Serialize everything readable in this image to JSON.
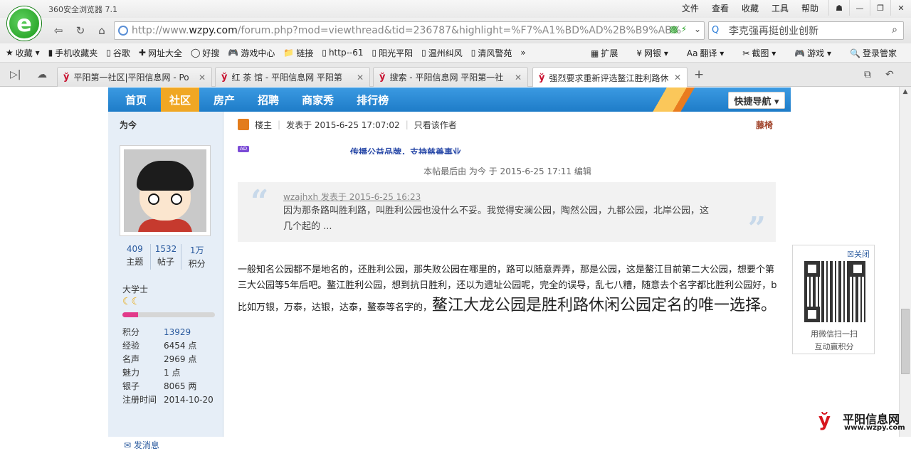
{
  "browser": {
    "title": "360安全浏览器 7.1",
    "logo_letter": "e",
    "menu": [
      "文件",
      "查看",
      "收藏",
      "工具",
      "帮助"
    ],
    "window_buttons": [
      "☗",
      "—",
      "❐",
      "✕"
    ]
  },
  "address": {
    "url_prefix": "http://www.",
    "url_domain": "wzpy.com",
    "url_rest": "/forum.php?mod=viewthread&tid=236787&highlight=%F7%A1%BD%AD%2B%B9%AB%",
    "search_text": "李克强再挺创业创新"
  },
  "bookmarks": {
    "items": [
      {
        "icon": "★",
        "label": "收藏"
      },
      {
        "icon": "▮",
        "label": "手机收藏夹"
      },
      {
        "icon": "▯",
        "label": "谷歌"
      },
      {
        "icon": "✚",
        "label": "网址大全"
      },
      {
        "icon": "◯",
        "label": "好搜"
      },
      {
        "icon": "🎮",
        "label": "游戏中心"
      },
      {
        "icon": "📁",
        "label": "链接"
      },
      {
        "icon": "▯",
        "label": "http--61"
      },
      {
        "icon": "▯",
        "label": "阳光平阳"
      },
      {
        "icon": "▯",
        "label": "温州纠风"
      },
      {
        "icon": "▯",
        "label": "清风警苑"
      }
    ],
    "more": "»",
    "right": [
      {
        "icon": "▦",
        "label": "扩展"
      },
      {
        "icon": "¥",
        "label": "网银"
      },
      {
        "icon": "Aa",
        "label": "翻译"
      },
      {
        "icon": "✂",
        "label": "截图"
      },
      {
        "icon": "🎮",
        "label": "游戏"
      },
      {
        "icon": "🔍",
        "label": "登录管家"
      }
    ]
  },
  "tabs": [
    {
      "label": "平阳第一社区|平阳信息网 - Po",
      "active": false
    },
    {
      "label": "红 茶 馆 - 平阳信息网 平阳第",
      "active": false
    },
    {
      "label": "搜索 - 平阳信息网 平阳第一社",
      "active": false
    },
    {
      "label": "强烈要求重新评选鳌江胜利路休",
      "active": true
    }
  ],
  "site": {
    "nav": [
      "首页",
      "社区",
      "房产",
      "招聘",
      "商家秀",
      "排行榜"
    ],
    "current": "社区",
    "quick_nav": "快捷导航 ▾"
  },
  "user": {
    "name": "为今",
    "stats": [
      {
        "n": "409",
        "l": "主题"
      },
      {
        "n": "1532",
        "l": "帖子"
      },
      {
        "n": "1万",
        "l": "积分"
      }
    ],
    "rank": "大学士",
    "level_progress": 0.17,
    "profile": [
      {
        "k": "积分",
        "v": "13929",
        "link": true
      },
      {
        "k": "经验",
        "v": "6454 点",
        "link": false
      },
      {
        "k": "名声",
        "v": "2969 点",
        "link": false
      },
      {
        "k": "魅力",
        "v": "1 点",
        "link": false
      },
      {
        "k": "银子",
        "v": "8065 两",
        "link": false
      },
      {
        "k": "注册时间",
        "v": "2014-10-20",
        "link": false
      }
    ],
    "send_message": "发消息"
  },
  "post": {
    "role": "楼主",
    "posted": "发表于 2015-6-25 17:07:02",
    "only_author": "只看该作者",
    "floor": "藤椅",
    "ad_badge": "AD",
    "ad_text": "传播公益品牌，支持慈善事业",
    "edit_note": "本帖最后由 为今 于 2015-6-25 17:11 编辑",
    "quote": {
      "author": "wzajhxh 发表于 2015-6-25 16:23",
      "text": "因为那条路叫胜利路，叫胜利公园也没什么不妥。我觉得安澜公园，陶然公园，九都公园，北岸公园，这几个起的 ..."
    },
    "body": "一般知名公园都不是地名的，还胜利公园，那失败公园在哪里的，路可以随意弄弄，那是公园，这是鳌江目前第二大公园，想要个第三大公园等5年后吧。鳌江胜利公园，想到抗日胜利，还以为遗址公园呢，完全的误导，乱七八糟，随意去个名字都比胜利公园好，b比如万银，万泰，达银，达泰，鳌泰等名字的，",
    "body_big": "鳌江大龙公园是胜利路休闲公园定名的唯一选择。"
  },
  "qr": {
    "close": "☒关闭",
    "line1": "用微信扫一扫",
    "line2": "互动赢积分"
  },
  "watermark": {
    "name": "平阳信息网",
    "url": "www.wzpy.com"
  }
}
